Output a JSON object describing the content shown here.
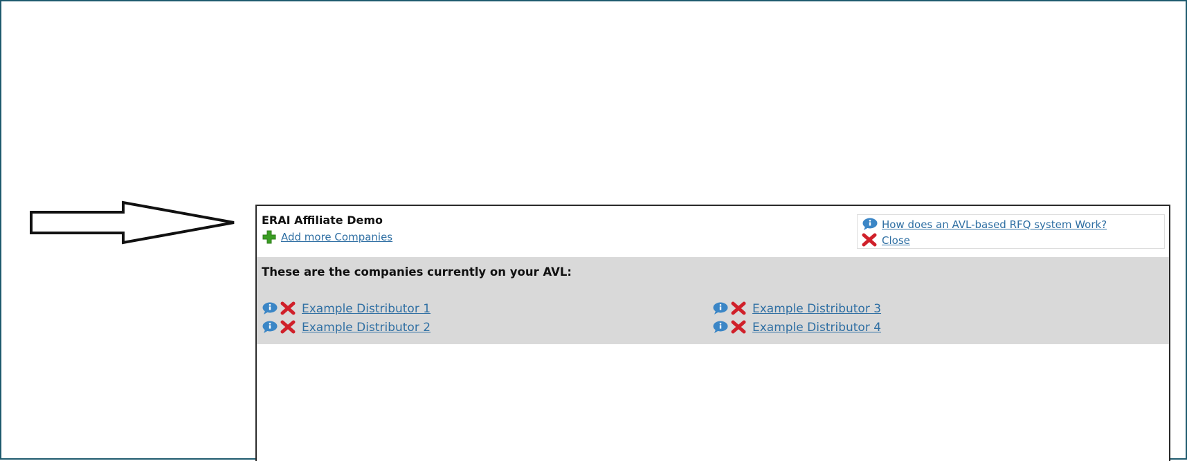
{
  "window": {
    "frame_color": "#1e5a6e"
  },
  "header": {
    "title": "ERAI Affiliate Demo",
    "add_companies_label": "Add more Companies",
    "help_link_label": "How does an AVL-based RFQ system Work?",
    "close_label": "Close"
  },
  "avl": {
    "heading": "These are the companies currently on your AVL:",
    "background": "#d9d9d9",
    "distributors": [
      {
        "label": "Example Distributor 1"
      },
      {
        "label": "Example Distributor 2"
      },
      {
        "label": "Example Distributor 3"
      },
      {
        "label": "Example Distributor 4"
      }
    ]
  },
  "icons": {
    "info": "info-bubble-icon",
    "remove": "red-x-icon",
    "add": "green-plus-icon",
    "annotation": "arrow-right-icon"
  },
  "colors": {
    "link": "#2f6fa3",
    "remove_red": "#d0202a",
    "add_green": "#3a9d23",
    "info_blue": "#3b86c6"
  }
}
